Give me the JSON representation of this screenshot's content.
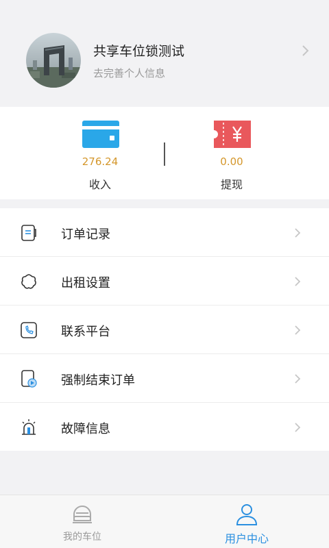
{
  "profile": {
    "name": "共享车位锁测试",
    "subtitle": "去完善个人信息"
  },
  "wallet": {
    "income": {
      "value": "276.24",
      "label": "收入",
      "icon": "card-icon",
      "color": "#2aa7e8"
    },
    "withdraw": {
      "value": "0.00",
      "label": "提现",
      "icon": "yen-ticket-icon",
      "color": "#e9585c"
    },
    "value_color": "#d4962a"
  },
  "menu": {
    "items": [
      {
        "label": "订单记录",
        "icon": "order-record-icon"
      },
      {
        "label": "出租设置",
        "icon": "flower-settings-icon"
      },
      {
        "label": "联系平台",
        "icon": "phone-icon"
      },
      {
        "label": "强制结束订单",
        "icon": "play-document-icon"
      },
      {
        "label": "故障信息",
        "icon": "alarm-light-icon"
      }
    ]
  },
  "tabbar": {
    "tabs": [
      {
        "label": "我的车位",
        "icon": "car-icon",
        "active": false
      },
      {
        "label": "用户中心",
        "icon": "user-icon",
        "active": true
      }
    ],
    "active_color": "#2a8fe0"
  }
}
